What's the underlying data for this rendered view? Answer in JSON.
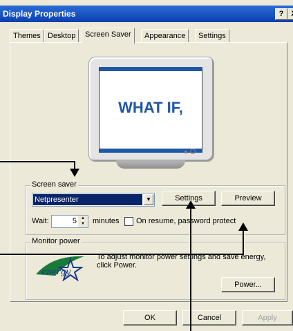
{
  "window": {
    "title": "Display Properties",
    "help_btn": "?",
    "close_btn": "X"
  },
  "tabs": [
    {
      "label": "Themes"
    },
    {
      "label": "Desktop"
    },
    {
      "label": "Screen Saver",
      "active": true
    },
    {
      "label": "Appearance"
    },
    {
      "label": "Settings"
    }
  ],
  "preview": {
    "screen_text": "WHAT IF,"
  },
  "screen_saver": {
    "group_label": "Screen saver",
    "selected": "Netpresenter",
    "settings_label": "Settings",
    "preview_label": "Preview",
    "wait_label": "Wait:",
    "wait_value": "5",
    "minutes_label": "minutes",
    "on_resume_label": "On resume, password protect"
  },
  "monitor_power": {
    "group_label": "Monitor power",
    "description": "To adjust monitor power settings and save energy, click Power.",
    "power_label": "Power...",
    "logo_text": "energy"
  },
  "footer": {
    "ok_label": "OK",
    "cancel_label": "Cancel",
    "apply_label": "Apply"
  },
  "colors": {
    "titlebar": "#0a3fb0",
    "selection": "#0a246a",
    "face": "#ece9d8",
    "screen_accent": "#1f57a8"
  }
}
